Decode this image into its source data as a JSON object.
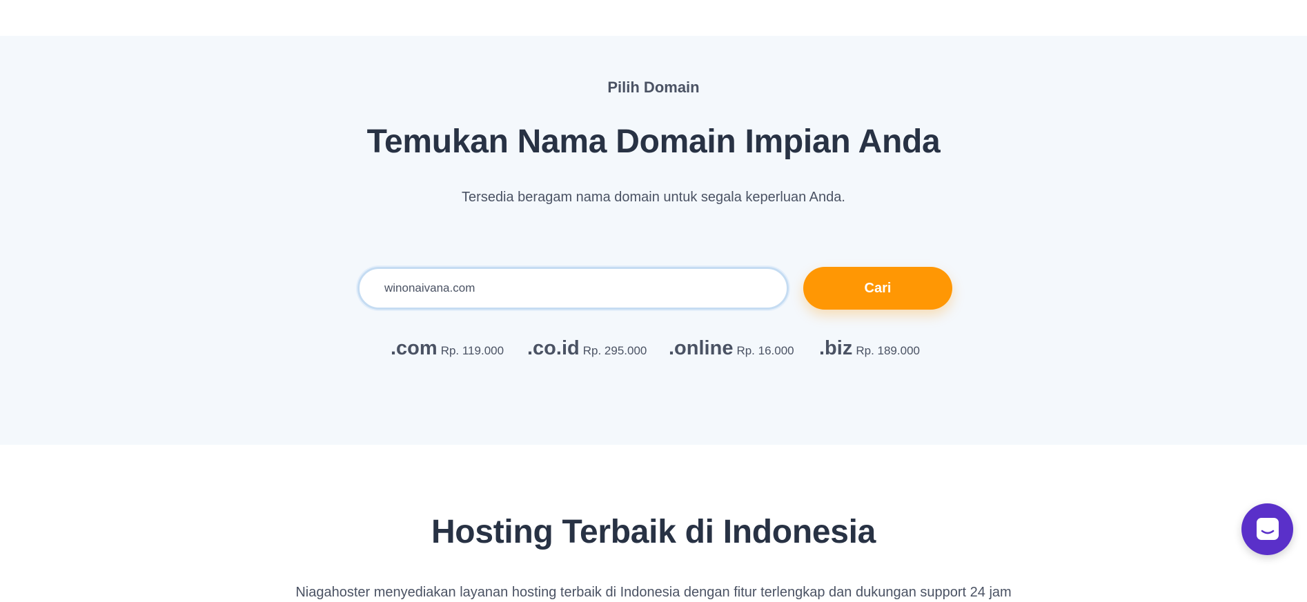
{
  "domain_section": {
    "eyebrow": "Pilih Domain",
    "headline": "Temukan Nama Domain Impian Anda",
    "subtext": "Tersedia beragam nama domain untuk segala keperluan Anda.",
    "search": {
      "value": "winonaivana.com",
      "button_label": "Cari"
    },
    "tlds": [
      {
        "name": ".com",
        "price": "Rp. 119.000"
      },
      {
        "name": ".co.id",
        "price": "Rp. 295.000"
      },
      {
        "name": ".online",
        "price": "Rp. 16.000"
      },
      {
        "name": ".biz",
        "price": "Rp. 189.000"
      }
    ]
  },
  "hosting_section": {
    "title": "Hosting Terbaik di Indonesia",
    "description": "Niagahoster menyediakan layanan hosting terbaik di Indonesia dengan fitur terlengkap dan dukungan support 24 jam"
  },
  "chat": {
    "icon": "chat-bubble-icon"
  },
  "colors": {
    "accent": "#ff9704",
    "section_bg": "#f4f8fc",
    "heading": "#283244",
    "chat": "#5a30c9"
  }
}
